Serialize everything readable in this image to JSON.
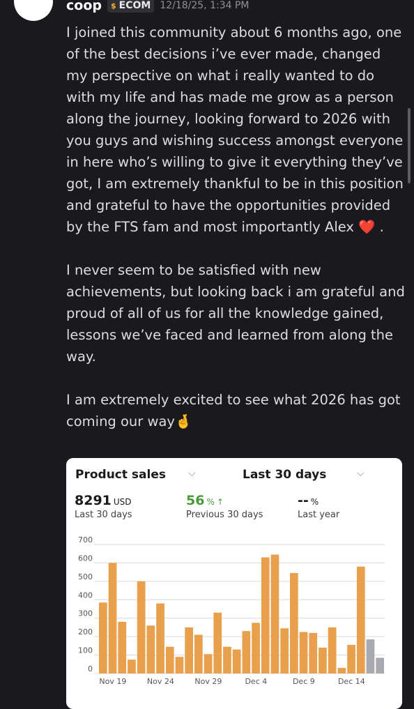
{
  "message": {
    "username": "coop",
    "tag": {
      "icon": "money-bag-icon",
      "label": "ECOM"
    },
    "timestamp": "12/18/25, 1:34 PM",
    "paragraphs": [
      "I joined this community about 6 months ago, one of the best decisions i’ve ever made, changed my perspective on what i really wanted to do with my life and has made me grow as a person along the journey, looking forward to 2026 with you guys and wishing success amongst everyone in here who’s willing to give it everything they’ve got, I am extremely thankful to be in this position and grateful to have the opportunities provided by the FTS fam and most importantly Alex",
      "I never seem to be satisfied with new achievements, but looking back i am grateful and proud of all of us for all the knowledge gained, lessons we’ve faced and learned from along the way.",
      "I am extremely excited to see what 2026 has got coming our way"
    ],
    "emoji_heart": "❤️",
    "emoji_period": ".",
    "emoji_fingers": "🤞"
  },
  "card": {
    "title": "Product sales",
    "period": "Last 30 days",
    "metrics": [
      {
        "value": "8291",
        "unit": "USD",
        "sub": "Last 30 days"
      },
      {
        "value": "56",
        "unit": "%",
        "arrow": "↑",
        "sub": "Previous 30 days"
      },
      {
        "value": "--",
        "unit": "%",
        "sub": "Last year"
      }
    ]
  },
  "chart_data": {
    "type": "bar",
    "ylim": [
      0,
      700
    ],
    "yticks": [
      0,
      100,
      200,
      300,
      400,
      500,
      600,
      700
    ],
    "xtick_labels": [
      "Nov 19",
      "Nov 24",
      "Nov 29",
      "Dec 4",
      "Dec 9",
      "Dec 14"
    ],
    "series": [
      {
        "color": "#e8a04c",
        "values": [
          385,
          600,
          280,
          75,
          500,
          260,
          380,
          145,
          90,
          250,
          210,
          105,
          330,
          145,
          130,
          230,
          275,
          630,
          645,
          245,
          545,
          225,
          220,
          140,
          250,
          30,
          155,
          580
        ]
      },
      {
        "color": "#a9aab0",
        "values": [
          null,
          null,
          null,
          null,
          null,
          null,
          null,
          null,
          null,
          null,
          null,
          null,
          null,
          null,
          null,
          null,
          null,
          null,
          null,
          null,
          null,
          null,
          null,
          null,
          null,
          null,
          null,
          null,
          185,
          85
        ]
      }
    ],
    "grid": true
  }
}
